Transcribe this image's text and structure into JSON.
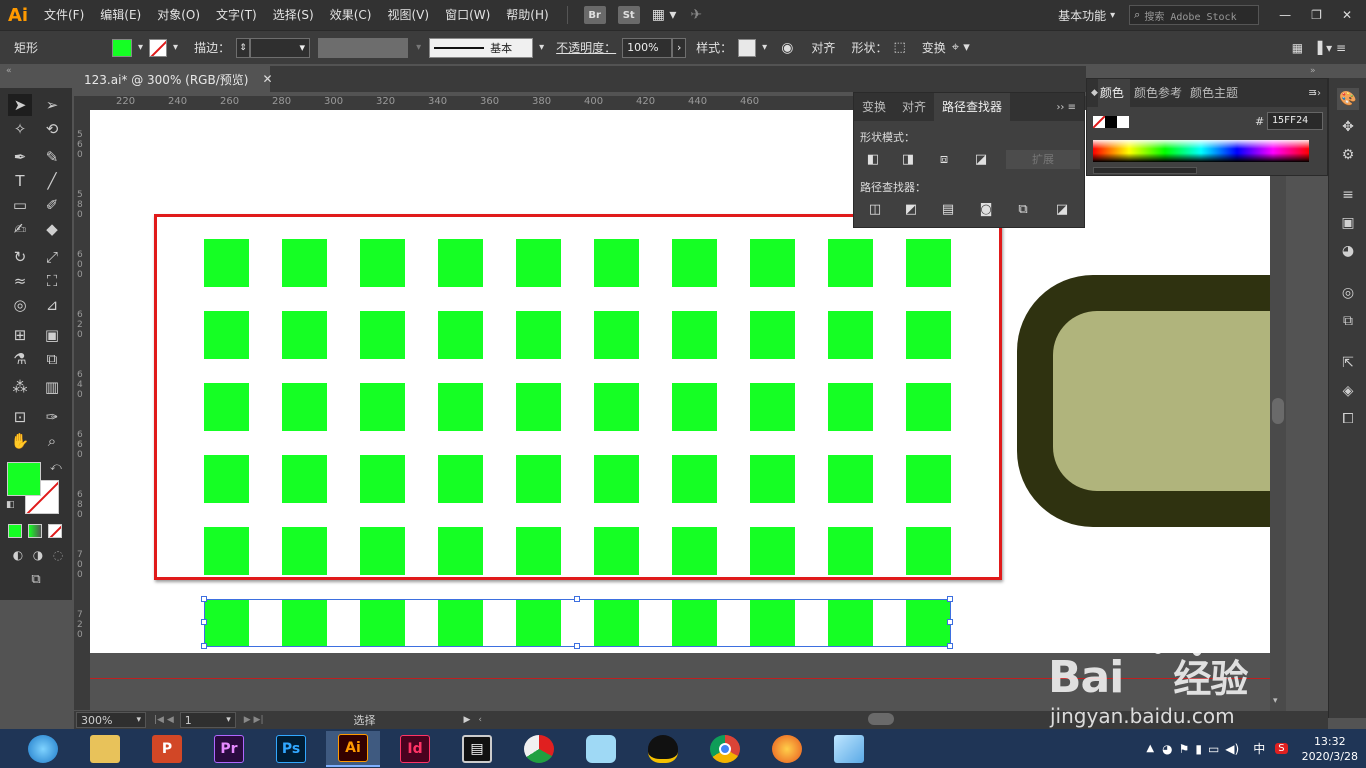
{
  "menu": {
    "logo": "Ai",
    "items": [
      "文件(F)",
      "编辑(E)",
      "对象(O)",
      "文字(T)",
      "选择(S)",
      "效果(C)",
      "视图(V)",
      "窗口(W)",
      "帮助(H)"
    ],
    "br": "Br",
    "st": "St",
    "workspace": "基本功能",
    "search_placeholder": "搜索 Adobe Stock"
  },
  "control": {
    "tool_name": "矩形",
    "fill_color": "#15ff24",
    "stroke_label": "描边：",
    "stroke_style": "基本",
    "opacity_label": "不透明度：",
    "opacity_value": "100%",
    "style_label": "样式：",
    "align_label": "对齐",
    "shape_label": "形状：",
    "transform_label": "变换"
  },
  "document": {
    "tab_title": "123.ai* @ 300% (RGB/预览)",
    "ruler_top": [
      "220",
      "240",
      "260",
      "280",
      "300",
      "320",
      "340",
      "360",
      "380",
      "400",
      "420",
      "440",
      "460"
    ],
    "ruler_left": [
      "560",
      "580",
      "600",
      "620",
      "640",
      "660",
      "680",
      "700",
      "720"
    ]
  },
  "canvas": {
    "square_color": "#15ff24",
    "highlight_color": "#e01a1a",
    "shape_dark": "#2f3210",
    "shape_light": "#b0b47c",
    "grid_rows": 5,
    "grid_cols": 10
  },
  "pathfinder_panel": {
    "tabs": [
      "变换",
      "对齐",
      "路径查找器"
    ],
    "shape_modes_label": "形状模式：",
    "expand_label": "扩展",
    "pathfinders_label": "路径查找器："
  },
  "color_panel": {
    "tabs": [
      "颜色",
      "颜色参考",
      "颜色主题"
    ],
    "hex_symbol": "#",
    "hex_value": "15FF24"
  },
  "status": {
    "zoom": "300%",
    "page": "1",
    "tool_text": "选择"
  },
  "taskbar": {
    "apps": [
      {
        "name": "P",
        "color": "#d24726"
      },
      {
        "name": "Pr",
        "color": "#2a0b3f"
      },
      {
        "name": "Ps",
        "color": "#001d34"
      },
      {
        "name": "Ai",
        "color": "#330000"
      },
      {
        "name": "Id",
        "color": "#49021f"
      }
    ],
    "ime": "中",
    "time": "13:32",
    "date": "2020/3/28"
  },
  "watermark": {
    "brand_prefix": "Bai",
    "brand_suffix": "经验",
    "url": "jingyan.baidu.com"
  }
}
